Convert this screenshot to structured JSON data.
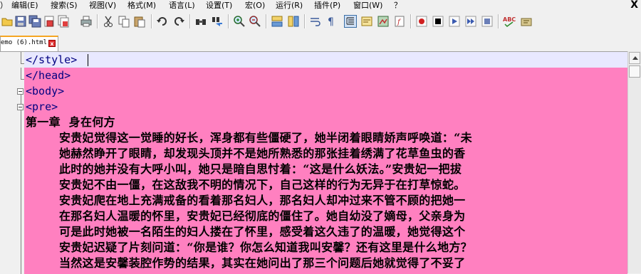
{
  "menu": {
    "items": [
      "）",
      "编辑(E)",
      "搜索(S)",
      "视图(V)",
      "格式(M)",
      "语言(L)",
      "设置(T)",
      "宏(O)",
      "运行(R)",
      "插件(P)",
      "窗口(W)",
      "？"
    ],
    "close": "X"
  },
  "toolbar": {
    "icons": [
      "open-icon",
      "save-icon",
      "save-all-icon",
      "close-icon",
      "close-all-icon",
      "print-icon",
      "cut-icon",
      "copy-icon",
      "paste-icon",
      "undo-icon",
      "redo-icon",
      "find-icon",
      "replace-icon",
      "zoom-in-icon",
      "zoom-out-icon",
      "sync-vertical-icon",
      "sync-horizontal-icon",
      "word-wrap-icon",
      "show-all-chars-icon",
      "indent-guide-icon",
      "user-language-icon",
      "doc-map-icon",
      "function-list-icon",
      "record-macro-icon",
      "stop-record-icon",
      "play-macro-icon",
      "play-multiple-icon",
      "save-macro-icon",
      "spell-check-icon",
      "language-icon"
    ]
  },
  "tab": {
    "label": "emo (6).html",
    "close": "x"
  },
  "editor": {
    "lines": [
      "</style>",
      "</head>",
      "<body>",
      "<pre>",
      "第一章  身在何方",
      "        安贵妃觉得这一觉睡的好长，浑身都有些僵硬了，她半闭着眼睛娇声呼唤道：“未",
      "        她赫然睁开了眼睛，却发现头顶并不是她所熟悉的那张挂着绣满了花草鱼虫的香",
      "        此时的她并没有大呼小叫，她只是暗自思忖着：“这是什么妖法。”安贵妃一把拔",
      "        安贵妃不由一僵，在这敌我不明的情况下，自己这样的行为无异于在打草惊蛇。",
      "        安贵妃爬在地上充满戒备的看着那名妇人，那名妇人却冲过来不管不顾的把她一",
      "        在那名妇人温暖的怀里，安贵妃已经彻底的僵住了。她自幼没了嫡母，父亲身为",
      "        可是此时她被一名陌生的妇人搂在了怀里，感受着这久违了的温暖，她觉得这个",
      "        安贵妃迟疑了片刻问道：“你是谁？你怎么知道我叫安馨？还有这里是什么地方？",
      "        当然这是安馨装腔作势的结果，其实在她问出了那三个问题后她就觉得了不妥了"
    ]
  }
}
